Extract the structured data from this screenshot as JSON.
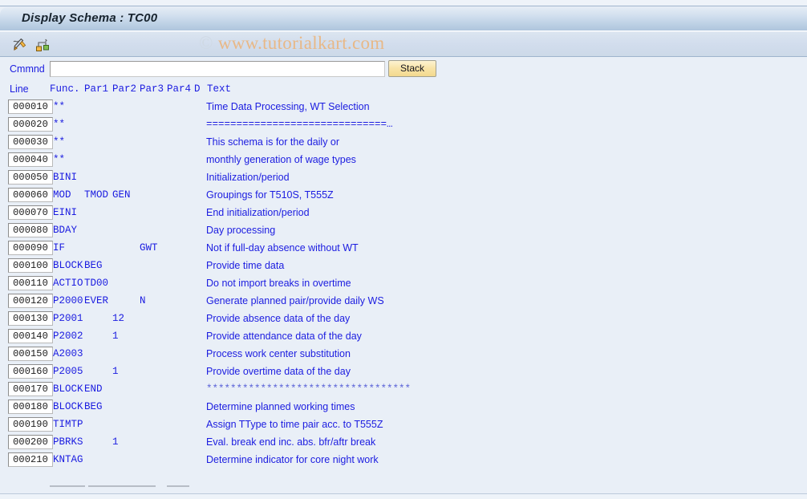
{
  "window": {
    "title": "Display Schema : TC00"
  },
  "watermark": {
    "copyright": "©",
    "text": " www.tutorialkart.com"
  },
  "toolbar": {
    "icons": [
      {
        "name": "pencil-edit-icon",
        "label": "Edit"
      },
      {
        "name": "hierarchy-structure-icon",
        "label": "Structure"
      }
    ]
  },
  "command": {
    "label": "Cmmnd",
    "value": "",
    "placeholder": "",
    "stack_label": "Stack"
  },
  "table": {
    "headers": {
      "line": "Line",
      "func": "Func.",
      "par1": "Par1",
      "par2": "Par2",
      "par3": "Par3",
      "par4": "Par4",
      "d": "D",
      "text": "Text"
    },
    "rows": [
      {
        "line": "000010",
        "func": "**",
        "par1": "",
        "par2": "",
        "par3": "",
        "par4": "",
        "d": "",
        "text": "Time Data Processing, WT Selection",
        "style": ""
      },
      {
        "line": "000020",
        "func": "**",
        "par1": "",
        "par2": "",
        "par3": "",
        "par4": "",
        "d": "",
        "text": "==============================…",
        "style": "eq"
      },
      {
        "line": "000030",
        "func": "**",
        "par1": "",
        "par2": "",
        "par3": "",
        "par4": "",
        "d": "",
        "text": "This schema is for the daily or",
        "style": ""
      },
      {
        "line": "000040",
        "func": "**",
        "par1": "",
        "par2": "",
        "par3": "",
        "par4": "",
        "d": "",
        "text": "monthly generation of wage types",
        "style": ""
      },
      {
        "line": "000050",
        "func": "BINI",
        "par1": "",
        "par2": "",
        "par3": "",
        "par4": "",
        "d": "",
        "text": "Initialization/period",
        "style": ""
      },
      {
        "line": "000060",
        "func": "MOD",
        "par1": "TMOD",
        "par2": "GEN",
        "par3": "",
        "par4": "",
        "d": "",
        "text": "Groupings for T510S, T555Z",
        "style": ""
      },
      {
        "line": "000070",
        "func": "EINI",
        "par1": "",
        "par2": "",
        "par3": "",
        "par4": "",
        "d": "",
        "text": "End initialization/period",
        "style": ""
      },
      {
        "line": "000080",
        "func": "BDAY",
        "par1": "",
        "par2": "",
        "par3": "",
        "par4": "",
        "d": "",
        "text": "Day processing",
        "style": ""
      },
      {
        "line": "000090",
        "func": "IF",
        "par1": "",
        "par2": "",
        "par3": "GWT",
        "par4": "",
        "d": "",
        "text": "Not if full-day absence without WT",
        "style": ""
      },
      {
        "line": "000100",
        "func": "BLOCK",
        "par1": "BEG",
        "par2": "",
        "par3": "",
        "par4": "",
        "d": "",
        "text": "Provide time data",
        "style": ""
      },
      {
        "line": "000110",
        "func": "ACTIO",
        "par1": "TD00",
        "par2": "",
        "par3": "",
        "par4": "",
        "d": "",
        "text": "Do not import breaks in overtime",
        "style": ""
      },
      {
        "line": "000120",
        "func": "P2000",
        "par1": "EVER",
        "par2": "",
        "par3": "N",
        "par4": "",
        "d": "",
        "text": "Generate planned pair/provide daily WS",
        "style": ""
      },
      {
        "line": "000130",
        "func": "P2001",
        "par1": "",
        "par2": "12",
        "par3": "",
        "par4": "",
        "d": "",
        "text": "Provide absence data of the day",
        "style": ""
      },
      {
        "line": "000140",
        "func": "P2002",
        "par1": "",
        "par2": "1",
        "par3": "",
        "par4": "",
        "d": "",
        "text": "Provide attendance data of the day",
        "style": ""
      },
      {
        "line": "000150",
        "func": "A2003",
        "par1": "",
        "par2": "",
        "par3": "",
        "par4": "",
        "d": "",
        "text": "Process work center substitution",
        "style": ""
      },
      {
        "line": "000160",
        "func": "P2005",
        "par1": "",
        "par2": "1",
        "par3": "",
        "par4": "",
        "d": "",
        "text": "Provide overtime data of the day",
        "style": ""
      },
      {
        "line": "000170",
        "func": "BLOCK",
        "par1": "END",
        "par2": "",
        "par3": "",
        "par4": "",
        "d": "",
        "text": "**********************************",
        "style": "ast"
      },
      {
        "line": "000180",
        "func": "BLOCK",
        "par1": "BEG",
        "par2": "",
        "par3": "",
        "par4": "",
        "d": "",
        "text": "Determine planned working times",
        "style": ""
      },
      {
        "line": "000190",
        "func": "TIMTP",
        "par1": "",
        "par2": "",
        "par3": "",
        "par4": "",
        "d": "",
        "text": "Assign TType to time pair acc. to T555Z",
        "style": ""
      },
      {
        "line": "000200",
        "func": "PBRKS",
        "par1": "",
        "par2": "1",
        "par3": "",
        "par4": "",
        "d": "",
        "text": "Eval. break end inc. abs. bfr/aftr break",
        "style": ""
      },
      {
        "line": "000210",
        "func": "KNTAG",
        "par1": "",
        "par2": "",
        "par3": "",
        "par4": "",
        "d": "",
        "text": "Determine indicator for core night work",
        "style": ""
      }
    ]
  },
  "colors": {
    "field_text": "#1b1ce0",
    "asterisk_text": "#5a62d8",
    "title_text": "#17232e",
    "watermark": "#e8b887",
    "stack_button": "#f8e3a6"
  }
}
